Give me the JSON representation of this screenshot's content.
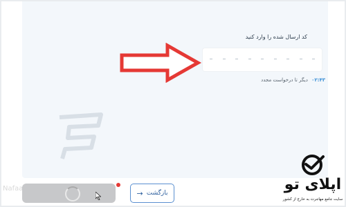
{
  "form": {
    "prompt": "کد ارسال شده را وارد کنید",
    "code_placeholder": "- - - - - - - - -",
    "timer": "۰۲:۴۳",
    "resend_text": "دیگر تا درخواست مجدد"
  },
  "footer": {
    "back_label": "بازگشت",
    "back_icon": "arrow-right-icon",
    "faint_logo_text": "Nafaa"
  },
  "brand": {
    "name": "اپلای تو",
    "tagline": "سایت جامع مهاجرت به خارج از کشور",
    "icon": "check-circle-icon"
  },
  "colors": {
    "card_background": "#f3f7fb",
    "accent": "#3b8fd6",
    "arrow": "#e53935",
    "loading_bar": "#c7c8ca"
  }
}
